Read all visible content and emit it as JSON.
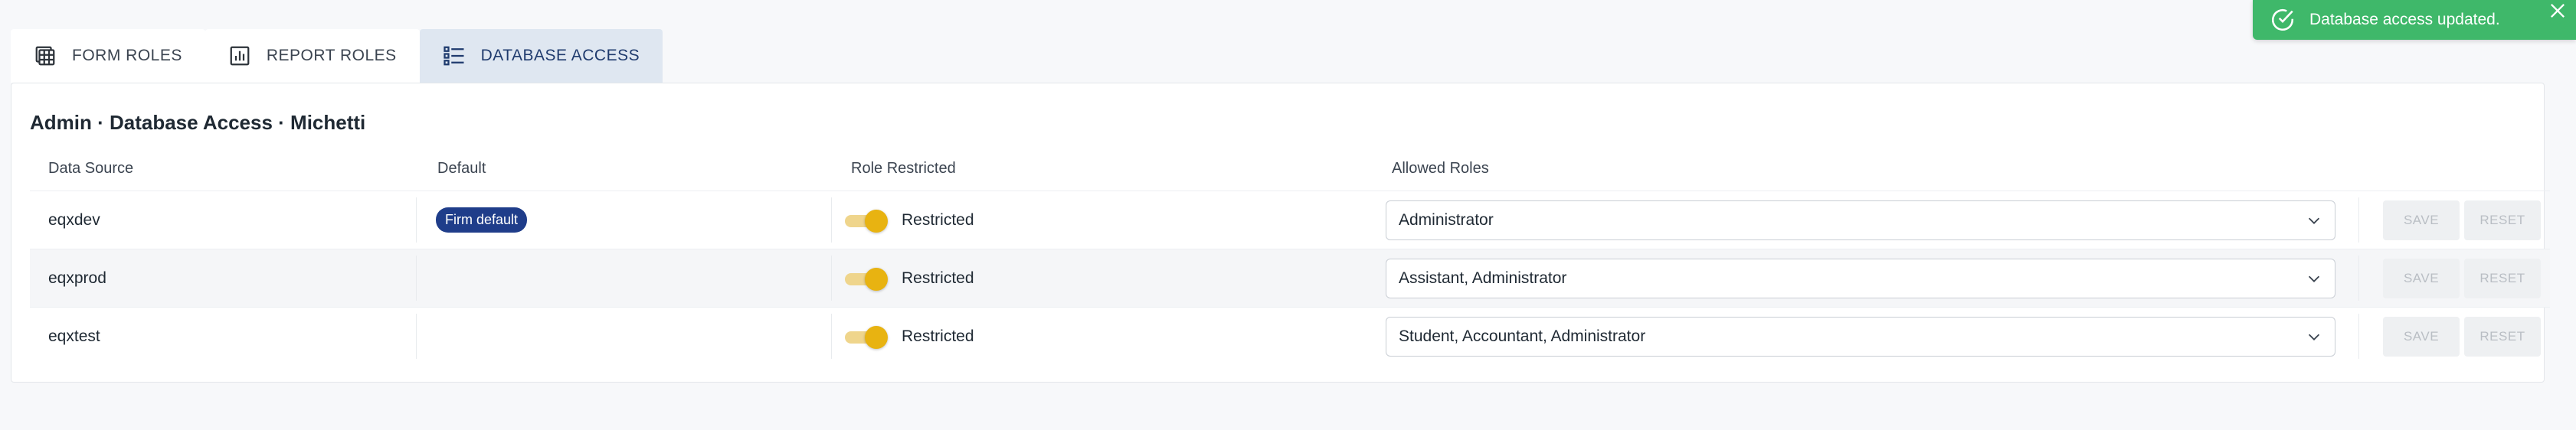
{
  "tabs": [
    {
      "label": "FORM ROLES",
      "icon": "form-table-icon",
      "active": false
    },
    {
      "label": "REPORT ROLES",
      "icon": "report-chart-icon",
      "active": false
    },
    {
      "label": "DATABASE ACCESS",
      "icon": "database-list-icon",
      "active": true
    }
  ],
  "page": {
    "title": "Admin · Database Access · Michetti"
  },
  "table": {
    "headers": {
      "data_source": "Data Source",
      "default": "Default",
      "role_restricted": "Role Restricted",
      "allowed_roles": "Allowed Roles"
    },
    "rows": [
      {
        "data_source": "eqxdev",
        "default_badge": "Firm default",
        "restricted_label": "Restricted",
        "restricted": true,
        "allowed_roles": "Administrator",
        "save_label": "SAVE",
        "reset_label": "RESET"
      },
      {
        "data_source": "eqxprod",
        "default_badge": "",
        "restricted_label": "Restricted",
        "restricted": true,
        "allowed_roles": "Assistant, Administrator",
        "save_label": "SAVE",
        "reset_label": "RESET"
      },
      {
        "data_source": "eqxtest",
        "default_badge": "",
        "restricted_label": "Restricted",
        "restricted": true,
        "allowed_roles": "Student, Accountant, Administrator",
        "save_label": "SAVE",
        "reset_label": "RESET"
      }
    ]
  },
  "toast": {
    "message": "Database access updated.",
    "icon": "check-circle-icon"
  },
  "colors": {
    "toast_bg": "#3fb86a",
    "badge_bg": "#1f3d8a",
    "toggle_knob": "#e8b311",
    "active_tab_bg": "#dfe7f1"
  }
}
